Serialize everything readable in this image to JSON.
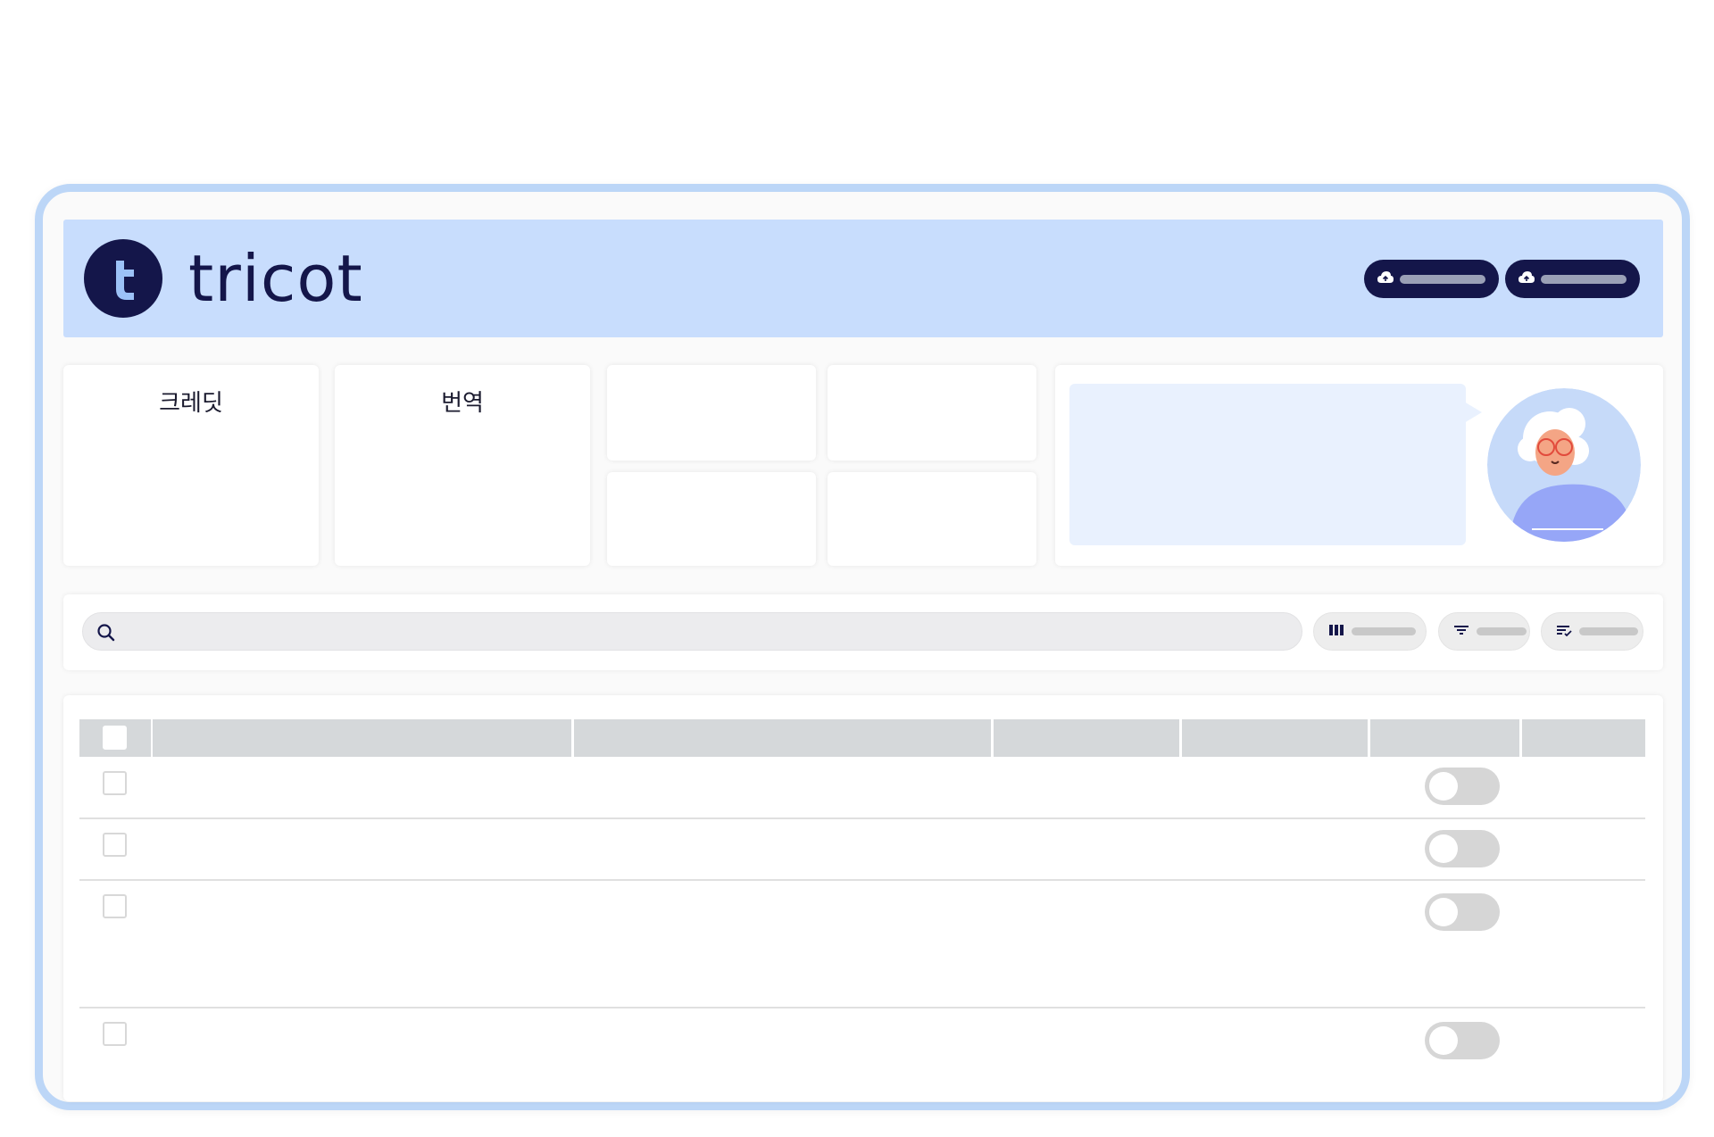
{
  "brand": {
    "name": "tricot",
    "logo_letter": "t"
  },
  "header": {
    "buttons": [
      {
        "icon": "cloud-upload-icon"
      },
      {
        "icon": "cloud-upload-icon"
      }
    ]
  },
  "cards": {
    "credit_title": "크레딧",
    "translation_title": "번역"
  },
  "toolbar": {
    "search": {
      "placeholder": ""
    },
    "pills": [
      {
        "icon": "columns-icon"
      },
      {
        "icon": "filter-icon"
      },
      {
        "icon": "sort-icon"
      }
    ]
  },
  "table": {
    "columns": [
      "",
      "",
      "",
      "",
      "",
      "",
      ""
    ],
    "rows": [
      {
        "checked": false,
        "toggle": false
      },
      {
        "checked": false,
        "toggle": false
      },
      {
        "checked": false,
        "toggle": false
      },
      {
        "checked": false,
        "toggle": false
      }
    ]
  },
  "colors": {
    "brand_navy": "#14164a",
    "header_blue": "#c8ddfd",
    "frame_blue": "#bcd6f7",
    "bubble_blue": "#e9f1fe"
  }
}
